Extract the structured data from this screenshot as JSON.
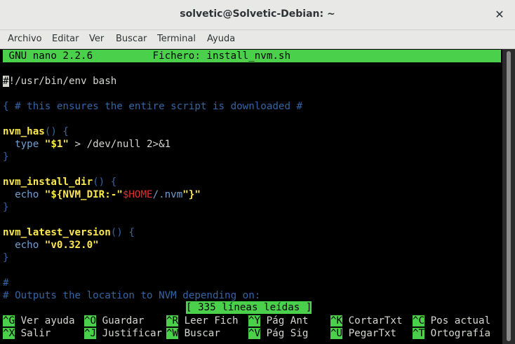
{
  "window": {
    "title": "solvetic@Solvetic-Debian: ~",
    "close_glyph": "✕"
  },
  "menu": [
    "Archivo",
    "Editar",
    "Ver",
    "Buscar",
    "Terminal",
    "Ayuda"
  ],
  "nano": {
    "header": " GNU nano 2.2.6          Fichero: install_nvm.sh",
    "lines": {
      "shebang_cursor": "#",
      "shebang_rest": "!/usr/bin/env bash",
      "comment1": "{ # this ensures the entire script is downloaded #",
      "fn1_name": "nvm_has",
      "fn1_open": "() {",
      "l_type_kw": "  type ",
      "l_type_arg": "\"$1\"",
      "l_type_rest": " > /dev/null 2>&1",
      "close1": "}",
      "fn2_name": "nvm_install_dir",
      "fn2_open": "() {",
      "echo_kw1": "  echo ",
      "echo1_a": "\"${NVM_DIR:-\"",
      "echo1_b": "$HOME",
      "echo1_c": "/.nvm",
      "echo1_d": "\"}\"",
      "close2": "}",
      "fn3_name": "nvm_latest_version",
      "fn3_open": "() {",
      "echo_kw2": "  echo ",
      "echo2_str": "\"v0.32.0\"",
      "close3": "}",
      "hash": "#",
      "comment2": "# Outputs the location to NVM depending on:"
    },
    "status": "[ 335 líneas leídas ]",
    "shortcuts_row1": [
      {
        "key": "^G",
        "label": " Ver ayuda"
      },
      {
        "key": "^O",
        "label": " Guardar"
      },
      {
        "key": "^R",
        "label": " Leer Fich"
      },
      {
        "key": "^Y",
        "label": " Pág Ant"
      },
      {
        "key": "^K",
        "label": " CortarTxt"
      },
      {
        "key": "^C",
        "label": " Pos actual"
      }
    ],
    "shortcuts_row2": [
      {
        "key": "^X",
        "label": " Salir"
      },
      {
        "key": "^J",
        "label": " Justificar"
      },
      {
        "key": "^W",
        "label": " Buscar"
      },
      {
        "key": "^V",
        "label": " Pág Sig"
      },
      {
        "key": "^U",
        "label": " PegarTxt"
      },
      {
        "key": "^T",
        "label": " Ortografía"
      }
    ]
  }
}
